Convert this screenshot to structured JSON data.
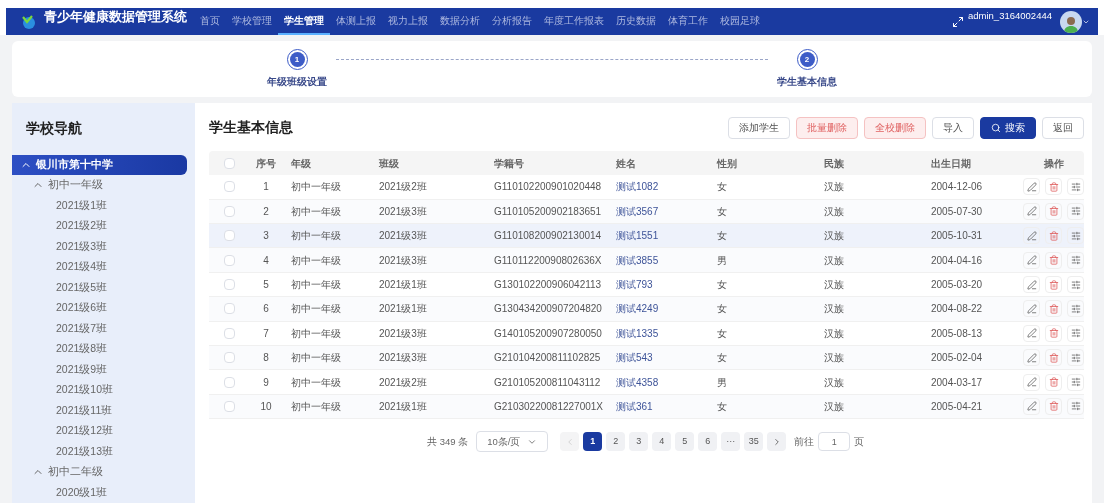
{
  "header": {
    "title": "青少年健康数据管理系统",
    "nav": [
      {
        "label": "首页",
        "selected": false
      },
      {
        "label": "学校管理",
        "selected": false
      },
      {
        "label": "学生管理",
        "selected": true
      },
      {
        "label": "体测上报",
        "selected": false
      },
      {
        "label": "视力上报",
        "selected": false
      },
      {
        "label": "数据分析",
        "selected": false
      },
      {
        "label": "分析报告",
        "selected": false
      },
      {
        "label": "年度工作报表",
        "selected": false
      },
      {
        "label": "历史数据",
        "selected": false
      },
      {
        "label": "体育工作",
        "selected": false
      },
      {
        "label": "校园足球",
        "selected": false
      }
    ],
    "username": "admin_3164002444"
  },
  "steps": [
    {
      "number": "1",
      "label": "年级班级设置"
    },
    {
      "number": "2",
      "label": "学生基本信息"
    }
  ],
  "sidebar": {
    "title": "学校导航",
    "tree": [
      {
        "label": "银川市第十中学",
        "selected": true,
        "expanded": true,
        "children": [
          {
            "label": "初中一年级",
            "selected": false,
            "expanded": true,
            "children": [
              {
                "label": "2021级1班",
                "selected": false
              },
              {
                "label": "2021级2班",
                "selected": false
              },
              {
                "label": "2021级3班",
                "selected": false
              },
              {
                "label": "2021级4班",
                "selected": false
              },
              {
                "label": "2021级5班",
                "selected": false
              },
              {
                "label": "2021级6班",
                "selected": false
              },
              {
                "label": "2021级7班",
                "selected": false
              },
              {
                "label": "2021级8班",
                "selected": false
              },
              {
                "label": "2021级9班",
                "selected": false
              },
              {
                "label": "2021级10班",
                "selected": false
              },
              {
                "label": "2021级11班",
                "selected": false
              },
              {
                "label": "2021级12班",
                "selected": false
              },
              {
                "label": "2021级13班",
                "selected": false
              }
            ]
          },
          {
            "label": "初中二年级",
            "selected": false,
            "expanded": true,
            "children": [
              {
                "label": "2020级1班",
                "selected": false
              }
            ]
          }
        ]
      }
    ]
  },
  "content": {
    "title": "学生基本信息",
    "buttons": [
      {
        "label": "添加学生",
        "kind": "default"
      },
      {
        "label": "批量删除",
        "kind": "danger"
      },
      {
        "label": "全校删除",
        "kind": "danger"
      },
      {
        "label": "导入",
        "kind": "default"
      },
      {
        "label": "搜索",
        "kind": "primary"
      },
      {
        "label": "返回",
        "kind": "default"
      }
    ],
    "table": {
      "select_all_checked": false,
      "columns": [
        "序号",
        "年级",
        "班级",
        "学籍号",
        "姓名",
        "性别",
        "民族",
        "出生日期",
        "操作"
      ],
      "rows": [
        {
          "cells": [
            "1",
            "初中一年级",
            "2021级2班",
            "G110102200901020448",
            "测试1082",
            "女",
            "汉族",
            "2004-12-06"
          ],
          "checked": false,
          "highlighted": false
        },
        {
          "cells": [
            "2",
            "初中一年级",
            "2021级3班",
            "G110105200902183651",
            "测试3567",
            "女",
            "汉族",
            "2005-07-30"
          ],
          "checked": false,
          "highlighted": false
        },
        {
          "cells": [
            "3",
            "初中一年级",
            "2021级3班",
            "G110108200902130014",
            "测试1551",
            "女",
            "汉族",
            "2005-10-31"
          ],
          "checked": false,
          "highlighted": true
        },
        {
          "cells": [
            "4",
            "初中一年级",
            "2021级3班",
            "G11011220090802636X",
            "测试3855",
            "男",
            "汉族",
            "2004-04-16"
          ],
          "checked": false,
          "highlighted": false
        },
        {
          "cells": [
            "5",
            "初中一年级",
            "2021级1班",
            "G130102200906042113",
            "测试793",
            "女",
            "汉族",
            "2005-03-20"
          ],
          "checked": false,
          "highlighted": false
        },
        {
          "cells": [
            "6",
            "初中一年级",
            "2021级1班",
            "G130434200907204820",
            "测试4249",
            "女",
            "汉族",
            "2004-08-22"
          ],
          "checked": false,
          "highlighted": false
        },
        {
          "cells": [
            "7",
            "初中一年级",
            "2021级3班",
            "G140105200907280050",
            "测试1335",
            "女",
            "汉族",
            "2005-08-13"
          ],
          "checked": false,
          "highlighted": false
        },
        {
          "cells": [
            "8",
            "初中一年级",
            "2021级3班",
            "G210104200811102825",
            "测试543",
            "女",
            "汉族",
            "2005-02-04"
          ],
          "checked": false,
          "highlighted": false
        },
        {
          "cells": [
            "9",
            "初中一年级",
            "2021级2班",
            "G210105200811043112",
            "测试4358",
            "男",
            "汉族",
            "2004-03-17"
          ],
          "checked": false,
          "highlighted": false
        },
        {
          "cells": [
            "10",
            "初中一年级",
            "2021级1班",
            "G21030220081227001X",
            "测试361",
            "女",
            "汉族",
            "2005-04-21"
          ],
          "checked": false,
          "highlighted": false
        }
      ]
    },
    "pagination": {
      "total": "共 349 条",
      "page_size": "10条/页",
      "pages": [
        {
          "label": "1",
          "selected": true
        },
        {
          "label": "2",
          "selected": false
        },
        {
          "label": "3",
          "selected": false
        },
        {
          "label": "4",
          "selected": false
        },
        {
          "label": "5",
          "selected": false
        },
        {
          "label": "6",
          "selected": false
        },
        {
          "label": "···",
          "selected": false
        },
        {
          "label": "35",
          "selected": false
        }
      ],
      "prev_disabled": true,
      "goto_label": "前往",
      "goto_value": "1",
      "goto_suffix": "页"
    }
  }
}
